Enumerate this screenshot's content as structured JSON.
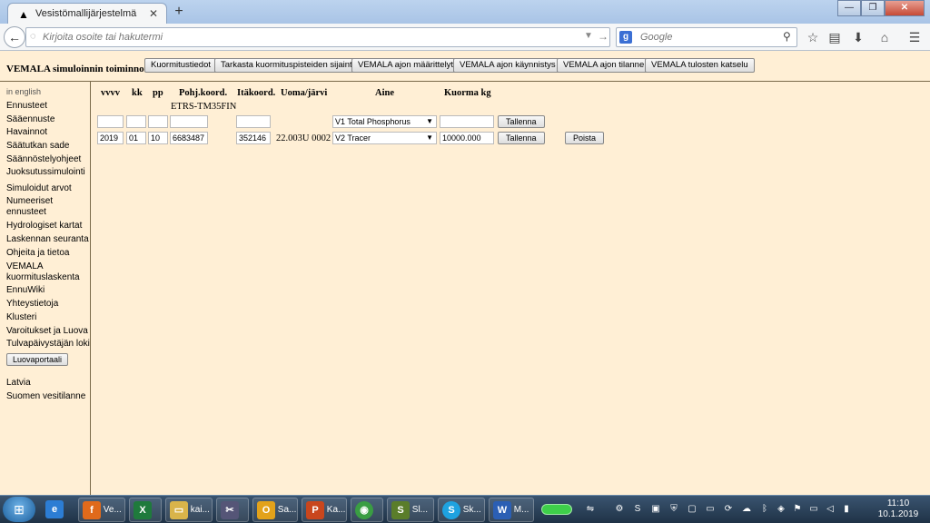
{
  "browser": {
    "tab_title": "Vesistömallijärjestelmä",
    "new_tab": "+",
    "url_placeholder": "Kirjoita osoite tai hakutermi",
    "search_placeholder": "Google",
    "window_buttons": {
      "minimize": "—",
      "restore": "❐",
      "close": "✕"
    }
  },
  "toolbar": {
    "label": "VEMALA simuloinnin toiminnot:",
    "buttons": [
      "Kuormitustiedot",
      "Tarkasta kuormituspisteiden sijainti",
      "VEMALA ajon määrittelyt",
      "VEMALA ajon käynnistys",
      "VEMALA ajon tilanne",
      "VEMALA tulosten katselu"
    ]
  },
  "sidebar": {
    "english": "in english",
    "items": [
      "Ennusteet",
      "Sääennuste",
      "Havainnot",
      "Säätutkan sade",
      "Säännöstelyohjeet",
      "Juoksutussimulointi",
      "Simuloidut arvot",
      "Numeeriset",
      "ennusteet",
      "Hydrologiset kartat",
      "Laskennan seuranta",
      "Ohjeita ja tietoa",
      "VEMALA",
      "kuormituslaskenta",
      "EnnuWiki",
      "Yhteystietoja",
      "Klusteri",
      "Varoitukset ja Luova",
      "Tulvapäivystäjän loki"
    ],
    "portal_button": "Luovaportaali",
    "footer_items": [
      "Latvia",
      "Suomen vesitilanne"
    ]
  },
  "table": {
    "headers": {
      "year": "vvvv",
      "month": "kk",
      "day": "pp",
      "north": "Pohj.koord.",
      "east": "Itäkoord.",
      "channel": "Uoma/järvi",
      "substance": "Aine",
      "load": "Kuorma kg"
    },
    "coord_system": "ETRS-TM35FIN",
    "new_row": {
      "year": "",
      "month": "",
      "day": "",
      "north": "",
      "east": "",
      "substance": "V1 Total Phosphorus",
      "load": "",
      "save": "Tallenna"
    },
    "rows": [
      {
        "year": "2019",
        "month": "01",
        "day": "10",
        "north": "6683487",
        "east": "352146",
        "channel": "22.003U 0002",
        "substance": "V2 Tracer",
        "load": "10000.000",
        "save": "Tallenna",
        "delete": "Poista"
      }
    ]
  },
  "taskbar": {
    "items": [
      {
        "icon": "firefox-icon",
        "label": "Ve..."
      },
      {
        "icon": "excel-icon",
        "label": ""
      },
      {
        "icon": "folder-icon",
        "label": "kai..."
      },
      {
        "icon": "snipping-icon",
        "label": ""
      },
      {
        "icon": "outlook-icon",
        "label": "Sa..."
      },
      {
        "icon": "powerpoint-icon",
        "label": "Ka..."
      },
      {
        "icon": "chrome-icon",
        "label": ""
      },
      {
        "icon": "sl-icon",
        "label": "Sl..."
      },
      {
        "icon": "skype-icon",
        "label": "Sk..."
      },
      {
        "icon": "word-icon",
        "label": "M..."
      }
    ],
    "clock_time": "11:10",
    "clock_date": "10.1.2019"
  },
  "colors": {
    "page_bg": "#ffefd5",
    "border": "#7a6a4a",
    "taskbar": "#1f3246"
  }
}
